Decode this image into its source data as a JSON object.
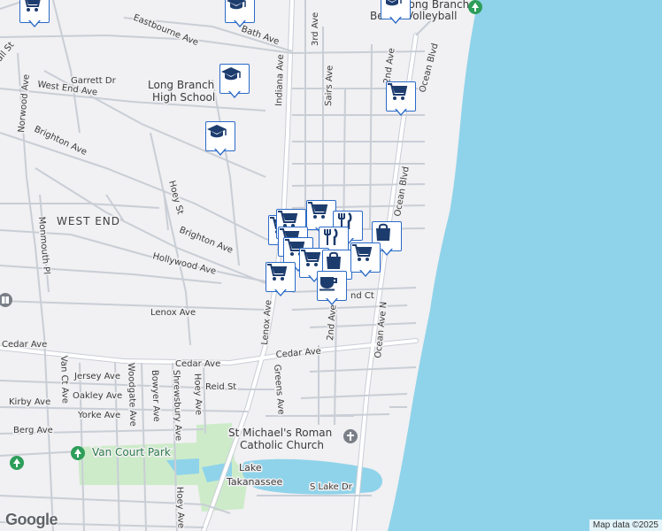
{
  "map": {
    "attribution": "Map data ©2025",
    "logo": "Google",
    "colors": {
      "land": "#f1f0f2",
      "water": "#8fd3ea",
      "park": "#cdebc9",
      "road": "#ffffff",
      "road_outline": "#c9ced6",
      "marker_border": "#2a6ac8",
      "marker_icon": "#1d3c6e",
      "poi_green": "#2e9e5b",
      "poi_gray": "#7a7f87"
    }
  },
  "labels": {
    "long_branch_high_school": [
      "Long Branch",
      "High School"
    ],
    "west_end": "WEST END",
    "van_court_park": "Van Court Park",
    "lake_takanassee": [
      "Lake",
      "Takanassee"
    ],
    "st_michaels": [
      "St Michael's Roman",
      "Catholic Church"
    ],
    "beach_volleyball": [
      "Long Branch",
      "Beach Volleyball"
    ]
  },
  "roads": {
    "eastbourne": "Eastbourne Ave",
    "bath": "Bath Ave",
    "garrett": "Garrett Dr",
    "west_end_ave": "West End Ave",
    "brighton_1": "Brighton Ave",
    "brighton_2": "Brighton Ave",
    "norwood": "Norwood Ave",
    "indiana": "Indiana Ave",
    "third": "3rd Ave",
    "sairs": "Sairs Ave",
    "second_top": "2nd Ave",
    "ocean_blvd_top": "Ocean Blvd",
    "ocean_blvd": "Ocean Blvd",
    "hoey": "Hoey St",
    "monmouth": "Monmouth Pl",
    "hollywood": "Hollywood Ave",
    "lenox": "Lenox Ave",
    "lenox_v": "Lenox Ave",
    "cedar_left": "Cedar Ave",
    "cedar_mid": "Cedar Ave",
    "cedar_right": "Cedar Ave",
    "greens": "Greens Ave",
    "second_ave": "2nd Ave",
    "ocean_ave": "Ocean Ave N",
    "jersey": "Jersey Ave",
    "oakley": "Oakley Ave",
    "kirby": "Kirby Ave",
    "reid": "Reid St",
    "yorke": "Yorke Ave",
    "berg": "Berg Ave",
    "van_ct": "Van Ct Ave",
    "woodgate": "Woodgate Ave",
    "bowyer": "Bowyer Ave",
    "shrewsbury": "Shrewsbury Ave",
    "hoey_ave": "Hoey Ave",
    "hoey_ave_2": "Hoey Ave",
    "s_lake": "S Lake Dr",
    "nd_ct": "nd Ct",
    "all_st": "all St"
  },
  "markers": [
    {
      "name": "shopping-cart-marker",
      "icon": "cart"
    },
    {
      "name": "school-marker",
      "icon": "school"
    },
    {
      "name": "school-marker",
      "icon": "school"
    },
    {
      "name": "school-marker",
      "icon": "school"
    },
    {
      "name": "school-marker",
      "icon": "school"
    },
    {
      "name": "shopping-cart-marker",
      "icon": "cart"
    },
    {
      "name": "shopping-cart-marker",
      "icon": "cart"
    },
    {
      "name": "shopping-cart-marker",
      "icon": "cart"
    },
    {
      "name": "shopping-cart-marker",
      "icon": "cart"
    },
    {
      "name": "restaurant-marker",
      "icon": "fork"
    },
    {
      "name": "shopping-cart-marker",
      "icon": "cart"
    },
    {
      "name": "restaurant-marker",
      "icon": "fork"
    },
    {
      "name": "shopping-bag-marker",
      "icon": "bag"
    },
    {
      "name": "shopping-cart-marker",
      "icon": "cart"
    },
    {
      "name": "shopping-cart-marker",
      "icon": "cart"
    },
    {
      "name": "shopping-bag-marker",
      "icon": "bag"
    },
    {
      "name": "shopping-cart-marker",
      "icon": "cart"
    },
    {
      "name": "shopping-cart-marker",
      "icon": "cart"
    },
    {
      "name": "cafe-marker",
      "icon": "cup"
    }
  ]
}
